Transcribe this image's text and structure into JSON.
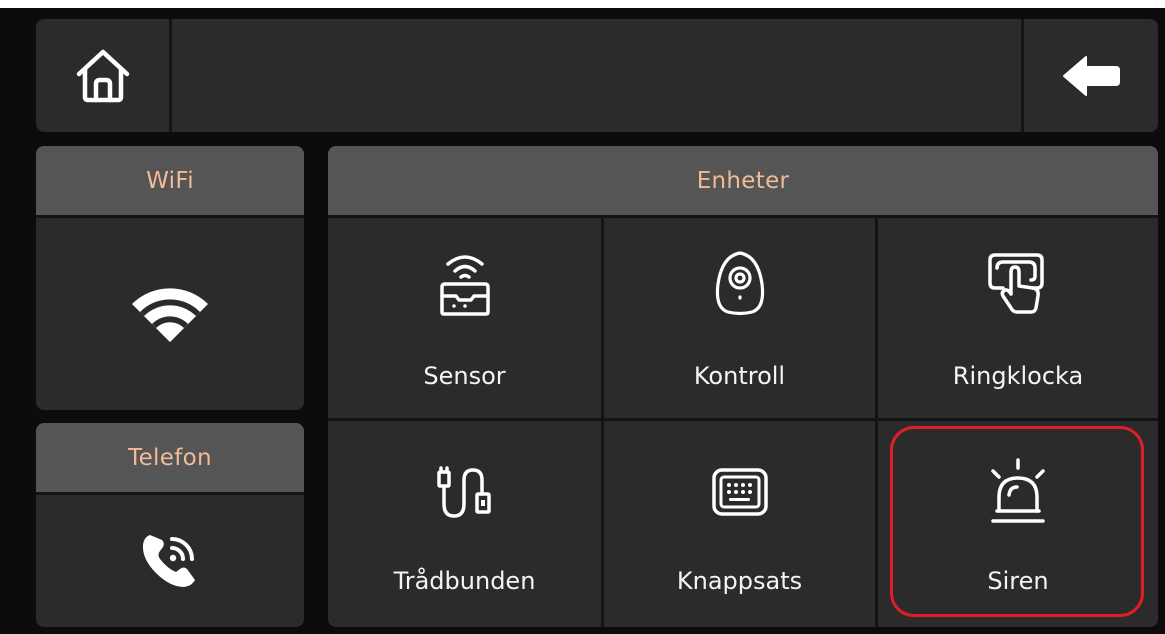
{
  "topbar": {
    "home_icon": "home-icon",
    "back_icon": "back-arrow-icon",
    "title": ""
  },
  "wifi": {
    "header": "WiFi",
    "icon": "wifi-icon"
  },
  "telefon": {
    "header": "Telefon",
    "icon": "phone-ringing-icon"
  },
  "enheter": {
    "header": "Enheter",
    "devices": [
      {
        "label": "Sensor",
        "icon": "wireless-sensor-icon"
      },
      {
        "label": "Kontroll",
        "icon": "remote-fob-icon"
      },
      {
        "label": "Ringklocka",
        "icon": "doorbell-press-icon"
      },
      {
        "label": "Trådbunden",
        "icon": "wired-cable-icon"
      },
      {
        "label": "Knappsats",
        "icon": "keypad-icon"
      },
      {
        "label": "Siren",
        "icon": "siren-icon",
        "selected": true
      }
    ]
  },
  "colors": {
    "panel": "#2b2b2b",
    "header": "#555555",
    "header_text": "#f2bb97",
    "highlight": "#e01e26"
  }
}
